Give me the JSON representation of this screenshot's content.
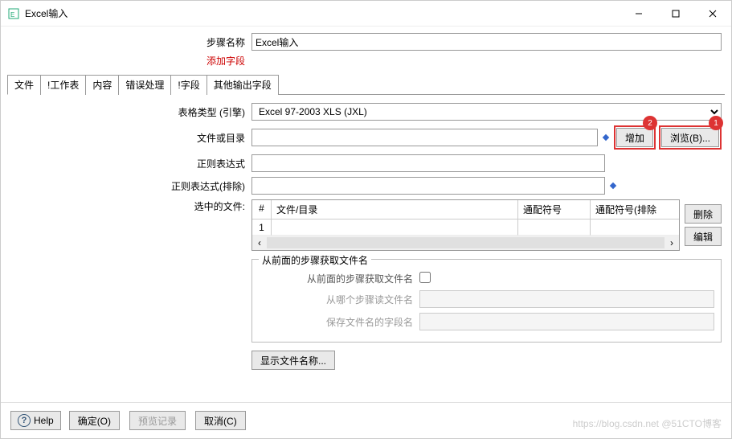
{
  "window": {
    "title": "Excel输入"
  },
  "header": {
    "step_name_label": "步骤名称",
    "step_name_value": "Excel输入",
    "add_fields_label": "添加字段"
  },
  "tabs": {
    "items": [
      {
        "label": "文件"
      },
      {
        "label": "!工作表"
      },
      {
        "label": "内容"
      },
      {
        "label": "错误处理"
      },
      {
        "label": "!字段"
      },
      {
        "label": "其他输出字段"
      }
    ]
  },
  "file_tab": {
    "engine_label": "表格类型 (引擎)",
    "engine_value": "Excel 97-2003 XLS (JXL)",
    "file_or_dir_label": "文件或目录",
    "file_or_dir_value": "",
    "add_btn": "增加",
    "browse_btn": "浏览(B)...",
    "badge_add": "2",
    "badge_browse": "1",
    "regex_label": "正则表达式",
    "regex_value": "",
    "regex_ex_label": "正则表达式(排除)",
    "regex_ex_value": "",
    "selected_files_label": "选中的文件:",
    "table": {
      "col_num": "#",
      "col_path": "文件/目录",
      "col_wc": "通配符号",
      "col_wcex": "通配符号(排除",
      "row1_num": "1"
    },
    "delete_btn": "删除",
    "edit_btn": "编辑",
    "group_title": "从前面的步骤获取文件名",
    "group_chk_label": "从前面的步骤获取文件名",
    "group_step_label": "从哪个步骤读文件名",
    "group_field_label": "保存文件名的字段名",
    "show_filenames_btn": "显示文件名称..."
  },
  "footer": {
    "help": "Help",
    "ok": "确定(O)",
    "preview": "预览记录",
    "cancel": "取消(C)"
  },
  "watermark": {
    "text1": "https://blog.csdn.net",
    "text2": "@51CTO博客"
  }
}
